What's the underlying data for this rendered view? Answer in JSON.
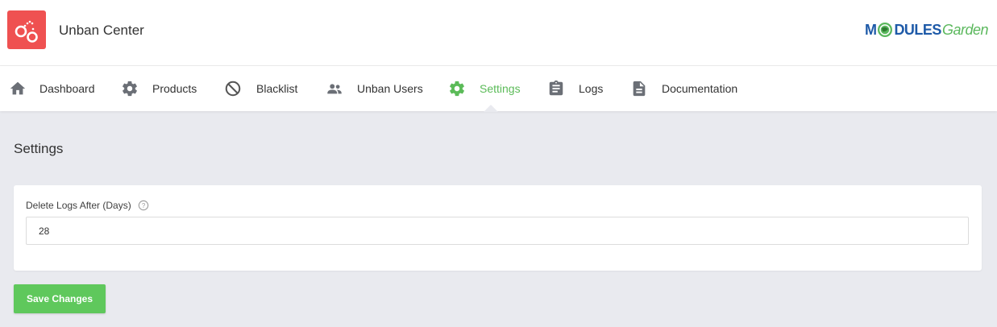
{
  "app": {
    "title": "Unban Center",
    "logo_icon": "handcuffs-icon",
    "logo_color": "#ef5151"
  },
  "brand": {
    "part1": "M",
    "part2": "DULES",
    "part3": "Garden",
    "primary_color": "#1e5aa8",
    "secondary_color": "#5bb85d"
  },
  "nav": {
    "active_index": 4,
    "active_color": "#5bbb58",
    "items": [
      {
        "label": "Dashboard",
        "icon": "home-icon"
      },
      {
        "label": "Products",
        "icon": "gear-icon"
      },
      {
        "label": "Blacklist",
        "icon": "block-icon"
      },
      {
        "label": "Unban Users",
        "icon": "users-icon"
      },
      {
        "label": "Settings",
        "icon": "gear-icon"
      },
      {
        "label": "Logs",
        "icon": "clipboard-icon"
      },
      {
        "label": "Documentation",
        "icon": "document-icon"
      }
    ]
  },
  "page": {
    "title": "Settings"
  },
  "form": {
    "delete_logs_label": "Delete Logs After (Days)",
    "delete_logs_help_icon": "help-icon",
    "delete_logs_value": "28"
  },
  "actions": {
    "save_label": "Save Changes",
    "save_color": "#5fc85c"
  }
}
